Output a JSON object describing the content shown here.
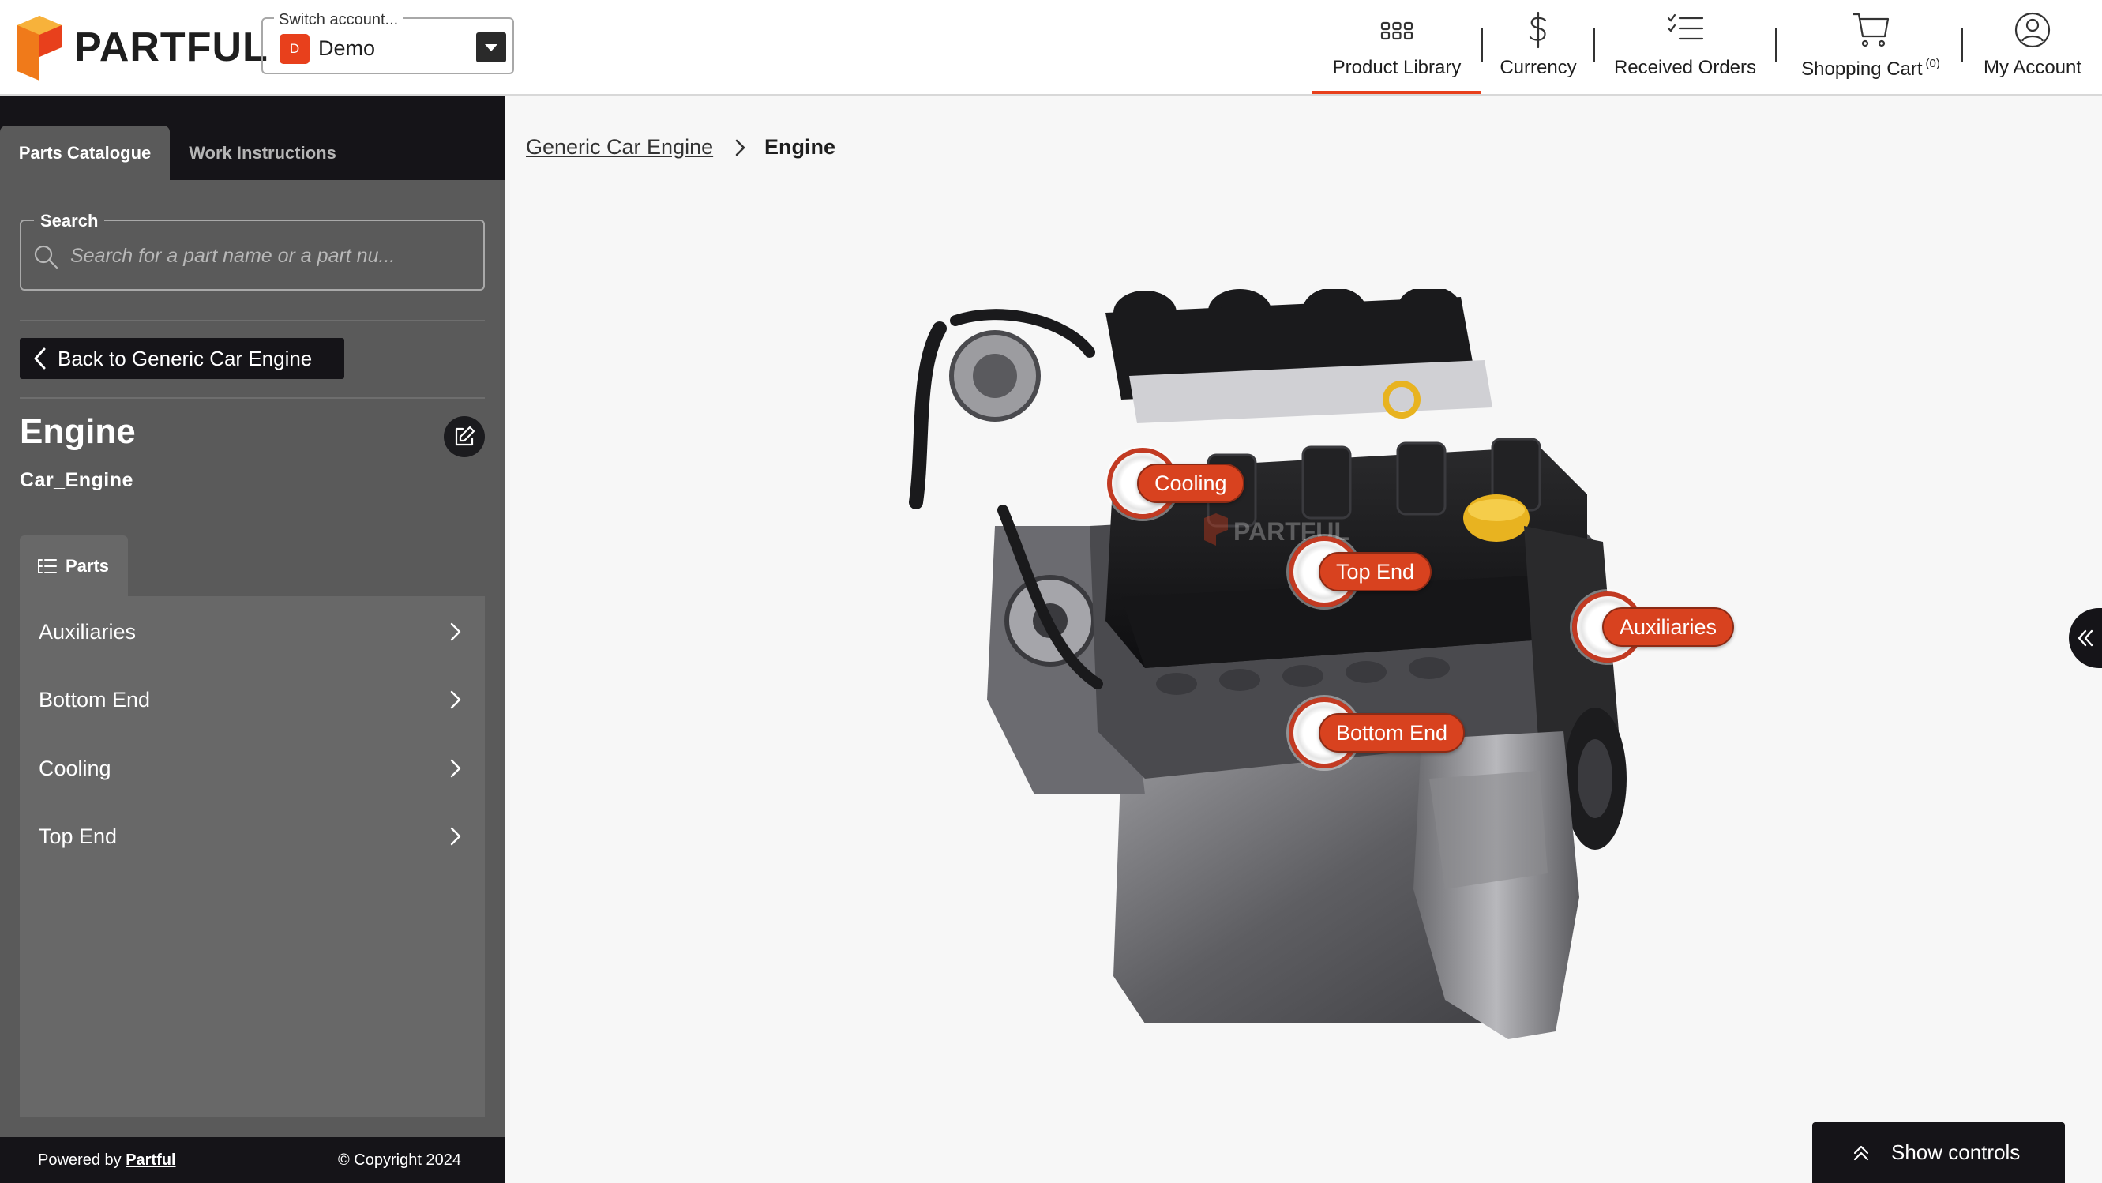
{
  "header": {
    "brand": "PARTFUL",
    "account_switcher": {
      "legend": "Switch account...",
      "badge": "D",
      "name": "Demo"
    },
    "nav": [
      {
        "label": "Product Library",
        "icon": "grid-icon",
        "active": true
      },
      {
        "label": "Currency",
        "icon": "dollar-icon"
      },
      {
        "label": "Received Orders",
        "icon": "checklist-icon"
      },
      {
        "label": "Shopping Cart",
        "icon": "cart-icon",
        "count": "(0)"
      },
      {
        "label": "My Account",
        "icon": "user-icon"
      }
    ]
  },
  "sidebar": {
    "tabs": [
      {
        "label": "Parts Catalogue",
        "active": true
      },
      {
        "label": "Work Instructions"
      }
    ],
    "search": {
      "legend": "Search",
      "placeholder": "Search for a part name or a part nu..."
    },
    "back_label": "Back to Generic Car Engine",
    "title": "Engine",
    "subtitle": "Car_Engine",
    "parts_tab_label": "Parts",
    "parts": [
      "Auxiliaries",
      "Bottom End",
      "Cooling",
      "Top End"
    ],
    "footer": {
      "powered_by": "Powered by",
      "powered_link": "Partful",
      "copyright": "© Copyright 2024"
    }
  },
  "main": {
    "breadcrumb": {
      "parent": "Generic Car Engine",
      "current": "Engine"
    },
    "hotspots": [
      "Cooling",
      "Top End",
      "Auxiliaries",
      "Bottom End"
    ],
    "controls_label": "Show controls"
  },
  "colors": {
    "accent": "#e8401c",
    "dark": "#151418",
    "sidebar": "#5a5a5a",
    "panel": "#686868"
  }
}
